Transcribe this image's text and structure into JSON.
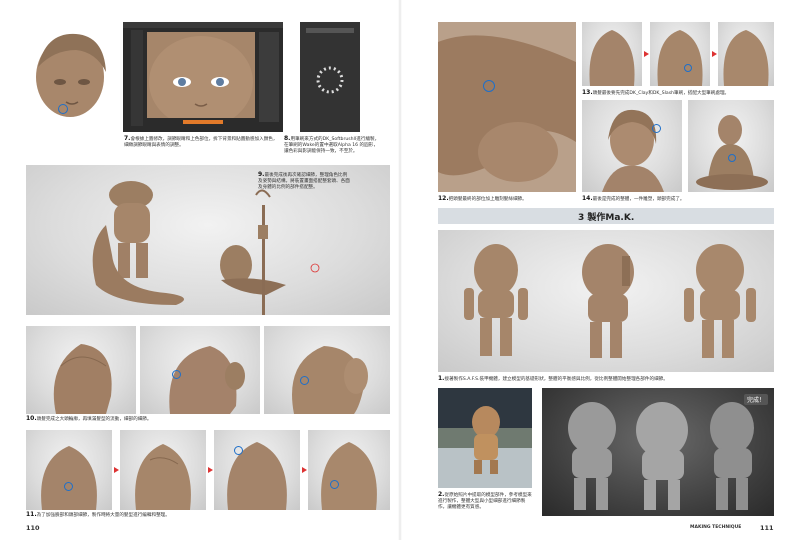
{
  "left_page": {
    "page_number": "110",
    "step7": {
      "num": "7.",
      "text": "會根據上圖修改，調節眼睛和上色部位，拆下背景和貼圖動感加入顏色，細緻調節眼睛與表情的調整。"
    },
    "step8": {
      "num": "8.",
      "text": "用筆刷來方式的DK_SoftbrushII進行繪製，在筆刷的Wake的置中選取Alpha 16 的圓形，讓色彩與影調能保持一致，不至於。"
    },
    "step9": {
      "num": "9.",
      "text": "最後完成後再次確認細節，整理角色比例及姿勢與結構，將裝置畫面搭配整套頭、各面及身體的比例的部件搭配整。"
    },
    "step10": {
      "num": "10.",
      "text": "頭髮完成之大頭輪廓，再填滿髮型的流動，細部的細節。"
    },
    "step11": {
      "num": "11.",
      "text": "為了加強臉部和頭部細節，製作時將大量的髮型進行編輯和整理。"
    }
  },
  "right_page": {
    "page_number": "111",
    "running_head": "MAKING TECHNIQUE",
    "step12": {
      "num": "12.",
      "text": "把頭髮最終的部位加上雕刻髮絲細節。"
    },
    "step13": {
      "num": "13.",
      "text": "頭髮最後要先完成DK_Clay和DK_Slash筆刷，搭配大型筆刷處理。"
    },
    "step14": {
      "num": "14.",
      "text": "最後是完成的整體，一件雕塑，頭部完成了。"
    },
    "section3": {
      "num": "3",
      "title": "製作Ma.K."
    },
    "step1": {
      "num": "1.",
      "text": "接著製作S.A.F.S.裝甲機體，建立模型的基礎形狀，整體的平衡感與比例，從比例整體開始整理各部件的細節。"
    },
    "step2": {
      "num": "2.",
      "text": "從原始照片中提取的模型部件，參考模型來進行製作，整體大型與小型細部進行細節製作，讓機體更有質感。"
    },
    "badge": "完成！"
  },
  "colors": {
    "accent": "#1e6fc9",
    "clay": "#a6866a",
    "section_bar": "#d8dde2"
  }
}
